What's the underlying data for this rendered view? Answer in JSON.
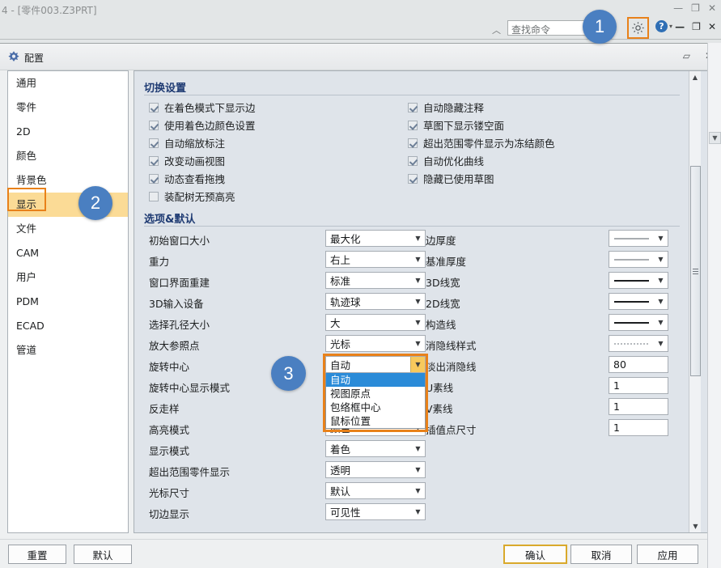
{
  "app": {
    "title": "4 - [零件003.Z3PRT]",
    "search_value": "查找命令",
    "window_buttons_top": [
      "—",
      "❐",
      "✕"
    ],
    "window_buttons_sub": [
      "—",
      "❐",
      "✕"
    ],
    "gear_icon": "gear-icon",
    "help_icon": "?",
    "caret": "▾",
    "chevron_up": "︿"
  },
  "dialog": {
    "title": "配置",
    "comment_icon": "▱",
    "close_icon": "✕"
  },
  "sidebar": {
    "items": [
      {
        "label": "通用",
        "selected": false
      },
      {
        "label": "零件",
        "selected": false
      },
      {
        "label": "2D",
        "selected": false
      },
      {
        "label": "颜色",
        "selected": false
      },
      {
        "label": "背景色",
        "selected": false
      },
      {
        "label": "显示",
        "selected": true
      },
      {
        "label": "文件",
        "selected": false
      },
      {
        "label": "CAM",
        "selected": false
      },
      {
        "label": "用户",
        "selected": false
      },
      {
        "label": "PDM",
        "selected": false
      },
      {
        "label": "ECAD",
        "selected": false
      },
      {
        "label": "管道",
        "selected": false
      }
    ]
  },
  "sections": {
    "toggle_title": "切换设置",
    "options_title": "选项&默认"
  },
  "checkboxes_left": [
    {
      "label": "在着色模式下显示边",
      "checked": true
    },
    {
      "label": "使用着色边颜色设置",
      "checked": true
    },
    {
      "label": "自动缩放标注",
      "checked": true
    },
    {
      "label": "改变动画视图",
      "checked": true
    },
    {
      "label": "动态查看拖拽",
      "checked": true
    },
    {
      "label": "装配树无预高亮",
      "checked": false
    }
  ],
  "checkboxes_right": [
    {
      "label": "自动隐藏注释",
      "checked": true
    },
    {
      "label": "草图下显示镂空面",
      "checked": true
    },
    {
      "label": "超出范围零件显示为冻结颜色",
      "checked": true
    },
    {
      "label": "自动优化曲线",
      "checked": true
    },
    {
      "label": "隐藏已使用草图",
      "checked": true
    }
  ],
  "fields_left": [
    {
      "label": "初始窗口大小",
      "value": "最大化",
      "type": "combo"
    },
    {
      "label": "重力",
      "value": "右上",
      "type": "combo"
    },
    {
      "label": "窗口界面重建",
      "value": "标准",
      "type": "combo"
    },
    {
      "label": "3D输入设备",
      "value": "轨迹球",
      "type": "combo"
    },
    {
      "label": "选择孔径大小",
      "value": "大",
      "type": "combo"
    },
    {
      "label": "放大参照点",
      "value": "光标",
      "type": "combo"
    },
    {
      "label": "旋转中心",
      "value": "自动",
      "type": "combo-open"
    },
    {
      "label": "旋转中心显示模式",
      "value": "",
      "type": "combo-hidden"
    },
    {
      "label": "反走样",
      "value": "",
      "type": "combo-hidden"
    },
    {
      "label": "高亮模式",
      "value": "颜色",
      "type": "combo"
    },
    {
      "label": "显示模式",
      "value": "着色",
      "type": "combo"
    },
    {
      "label": "超出范围零件显示",
      "value": "透明",
      "type": "combo"
    },
    {
      "label": "光标尺寸",
      "value": "默认",
      "type": "combo"
    },
    {
      "label": "切边显示",
      "value": "可见性",
      "type": "combo"
    }
  ],
  "fields_right": [
    {
      "label": "边厚度",
      "value": "",
      "type": "linestyle",
      "style": "thin-gray"
    },
    {
      "label": "基准厚度",
      "value": "",
      "type": "linestyle",
      "style": "thin-gray"
    },
    {
      "label": "3D线宽",
      "value": "",
      "type": "linestyle",
      "style": "thick-black"
    },
    {
      "label": "2D线宽",
      "value": "",
      "type": "linestyle",
      "style": "thick-black"
    },
    {
      "label": "构造线",
      "value": "",
      "type": "linestyle",
      "style": "thick-black"
    },
    {
      "label": "消隐线样式",
      "value": "",
      "type": "linestyle",
      "style": "dotted-gray"
    },
    {
      "label": "淡出消隐线",
      "value": "80",
      "type": "text"
    },
    {
      "label": "U素线",
      "value": "1",
      "type": "text"
    },
    {
      "label": "V素线",
      "value": "1",
      "type": "text"
    },
    {
      "label": "插值点尺寸",
      "value": "1",
      "type": "text"
    }
  ],
  "dropdown": {
    "for_field": "旋转中心",
    "options": [
      {
        "label": "自动",
        "active": true
      },
      {
        "label": "视图原点",
        "active": false
      },
      {
        "label": "包络框中心",
        "active": false
      },
      {
        "label": "鼠标位置",
        "active": false
      }
    ]
  },
  "footer": {
    "reset_label": "重置",
    "default_label": "默认",
    "ok_label": "确认",
    "cancel_label": "取消",
    "apply_label": "应用"
  },
  "callouts": [
    {
      "number": "1"
    },
    {
      "number": "2"
    },
    {
      "number": "3"
    }
  ],
  "colors": {
    "accent_orange": "#e8811a",
    "badge_blue": "#4a7fc1",
    "selection_blue": "#2a8bd8",
    "sidebar_highlight": "#fbdb96",
    "section_heading": "#1f3b73",
    "panel_bg": "#dfe4ea",
    "amber_button": "#f7c95c"
  }
}
